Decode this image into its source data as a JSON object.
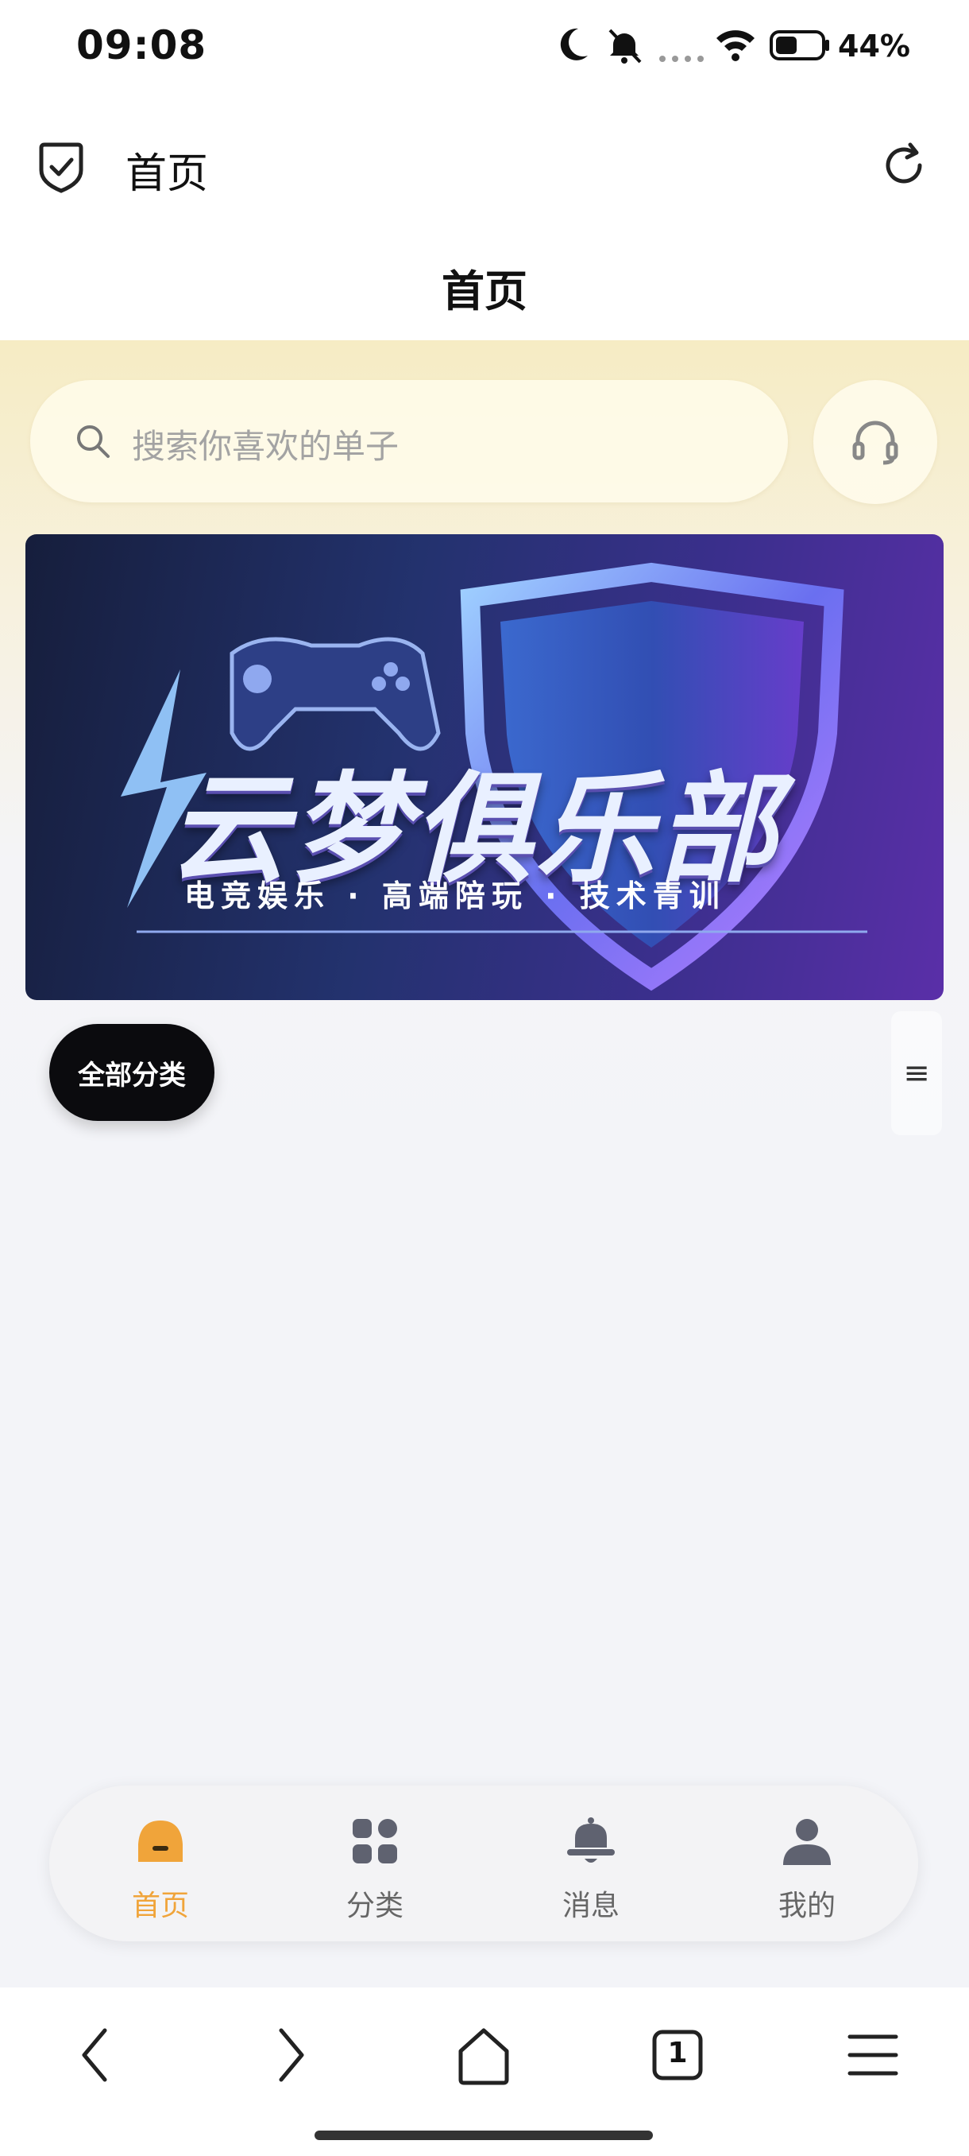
{
  "status_bar": {
    "time": "09:08",
    "battery": "44%",
    "icons": [
      "moon-icon",
      "mute-icon",
      "signal-dots-icon",
      "wifi-icon",
      "battery-icon"
    ]
  },
  "title_bar": {
    "title": "首页",
    "icons": [
      "shield-check-icon",
      "refresh-icon"
    ]
  },
  "page": {
    "header_title": "首页",
    "search_placeholder": "搜索你喜欢的单子",
    "banner": {
      "title": "云梦俱乐部",
      "subtitle": "电竞娱乐 · 高端陪玩 · 技术青训"
    },
    "category_button": "全部分类",
    "menu_icon": "≡"
  },
  "tabs": [
    {
      "label": "首页",
      "icon": "home-icon",
      "active": true
    },
    {
      "label": "分类",
      "icon": "grid-icon",
      "active": false
    },
    {
      "label": "消息",
      "icon": "bell-icon",
      "active": false
    },
    {
      "label": "我的",
      "icon": "user-icon",
      "active": false
    }
  ],
  "nav_bar": {
    "tab_count": "1",
    "icons": [
      "back-icon",
      "forward-icon",
      "home-icon",
      "tabs-icon",
      "menu-icon"
    ]
  },
  "colors": {
    "accent": "#f0a43a",
    "tab_inactive": "#666666",
    "category_button_bg": "#0b0b0e"
  }
}
